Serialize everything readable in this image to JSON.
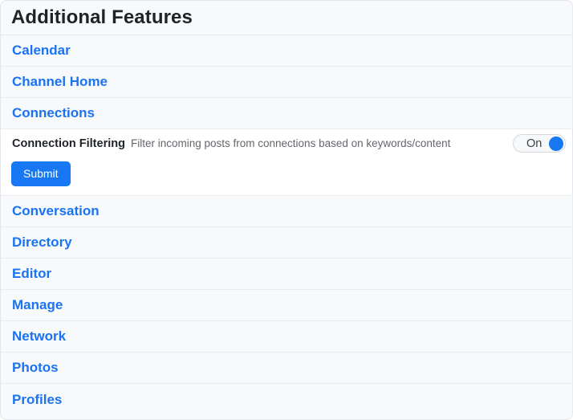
{
  "panel": {
    "title": "Additional Features"
  },
  "features": [
    {
      "label": "Calendar",
      "expanded": false
    },
    {
      "label": "Channel Home",
      "expanded": false
    },
    {
      "label": "Connections",
      "expanded": true
    },
    {
      "label": "Conversation",
      "expanded": false
    },
    {
      "label": "Directory",
      "expanded": false
    },
    {
      "label": "Editor",
      "expanded": false
    },
    {
      "label": "Manage",
      "expanded": false
    },
    {
      "label": "Network",
      "expanded": false
    },
    {
      "label": "Photos",
      "expanded": false
    },
    {
      "label": "Profiles",
      "expanded": false
    }
  ],
  "connections_panel": {
    "setting": {
      "label": "Connection Filtering",
      "description": "Filter incoming posts from connections based on keywords/content",
      "toggle": {
        "state_label": "On",
        "checked": true,
        "knob_color": "#1877f2"
      }
    },
    "submit_label": "Submit"
  },
  "colors": {
    "link": "#1a73f0",
    "accent": "#1877f2",
    "row_background": "#f8f9fb",
    "panel_background": "#ffffff",
    "separator": "#e9ecef",
    "title_text": "#1f2328",
    "description_text": "#63676c"
  }
}
